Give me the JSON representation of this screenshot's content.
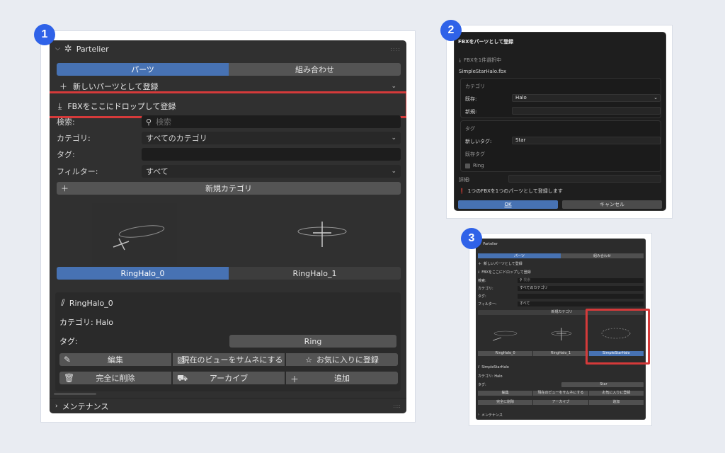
{
  "badges": [
    "1",
    "2",
    "3"
  ],
  "panel1": {
    "title": "Partelier",
    "tabs": [
      "パーツ",
      "組み合わせ"
    ],
    "new_part_label": "新しいパーツとして登録",
    "drop_label": "FBXをここにドロップして登録",
    "search_label": "検索:",
    "search_placeholder": "検索",
    "category_label": "カテゴリ:",
    "category_value": "すべてのカテゴリ",
    "tag_label": "タグ:",
    "filter_label": "フィルター:",
    "filter_value": "すべて",
    "new_category_label": "新規カテゴリ",
    "thumbnails": [
      "RingHalo_0",
      "RingHalo_1"
    ],
    "selected_name": "RingHalo_0",
    "selected_category": "カテゴリ: Halo",
    "tag_field_label": "タグ:",
    "tag_chip": "Ring",
    "actions_row1": [
      "編集",
      "現在のビューをサムネにする",
      "お気に入りに登録"
    ],
    "actions_row2": [
      "完全に削除",
      "アーカイブ",
      "追加"
    ],
    "maintenance_label": "メンテナンス"
  },
  "panel2": {
    "title": "FBXをパーツとして登録",
    "selected_count": "FBXを1件選択中",
    "filename": "SimpleStarHalo.fbx",
    "category_section": "カテゴリ",
    "existing_label": "既存:",
    "existing_value": "Halo",
    "new_label": "新規:",
    "new_value": "",
    "tag_section": "タグ",
    "new_tag_label": "新しいタグ:",
    "new_tag_value": "Star",
    "existing_tags_label": "既存タグ",
    "ring_checkbox_label": "Ring",
    "ring_checked": false,
    "detail_label": "詳細:",
    "info_text": "1つのFBXを1つのパーツとして登録します",
    "ok_label": "OK",
    "cancel_label": "キャンセル"
  },
  "panel3": {
    "title": "Partelier",
    "tabs": [
      "パーツ",
      "組み合わせ"
    ],
    "new_part_label": "新しいパーツとして登録",
    "drop_label": "FBXをここにドロップして登録",
    "search_label": "検索:",
    "search_placeholder": "検索",
    "category_label": "カテゴリ:",
    "category_value": "すべてのカテゴリ",
    "tag_label": "タグ:",
    "filter_label": "フィルター:",
    "filter_value": "すべて",
    "new_category_label": "新規カテゴリ",
    "thumbnails": [
      "RingHalo_0",
      "RingHalo_1",
      "SimpleStarHalo"
    ],
    "selected_name": "SimpleStarHalo",
    "selected_category": "カテゴリ: Halo",
    "tag_field_label": "タグ:",
    "tag_chip": "Star",
    "actions_row1": [
      "編集",
      "現在のビューをサムネにする",
      "お気に入りに登録"
    ],
    "actions_row2": [
      "完全に削除",
      "アーカイブ",
      "追加"
    ],
    "maintenance_label": "メンテナンス"
  },
  "colors": {
    "accent": "#4772b3",
    "highlight": "#d53a3a",
    "badge": "#2f62e8"
  }
}
